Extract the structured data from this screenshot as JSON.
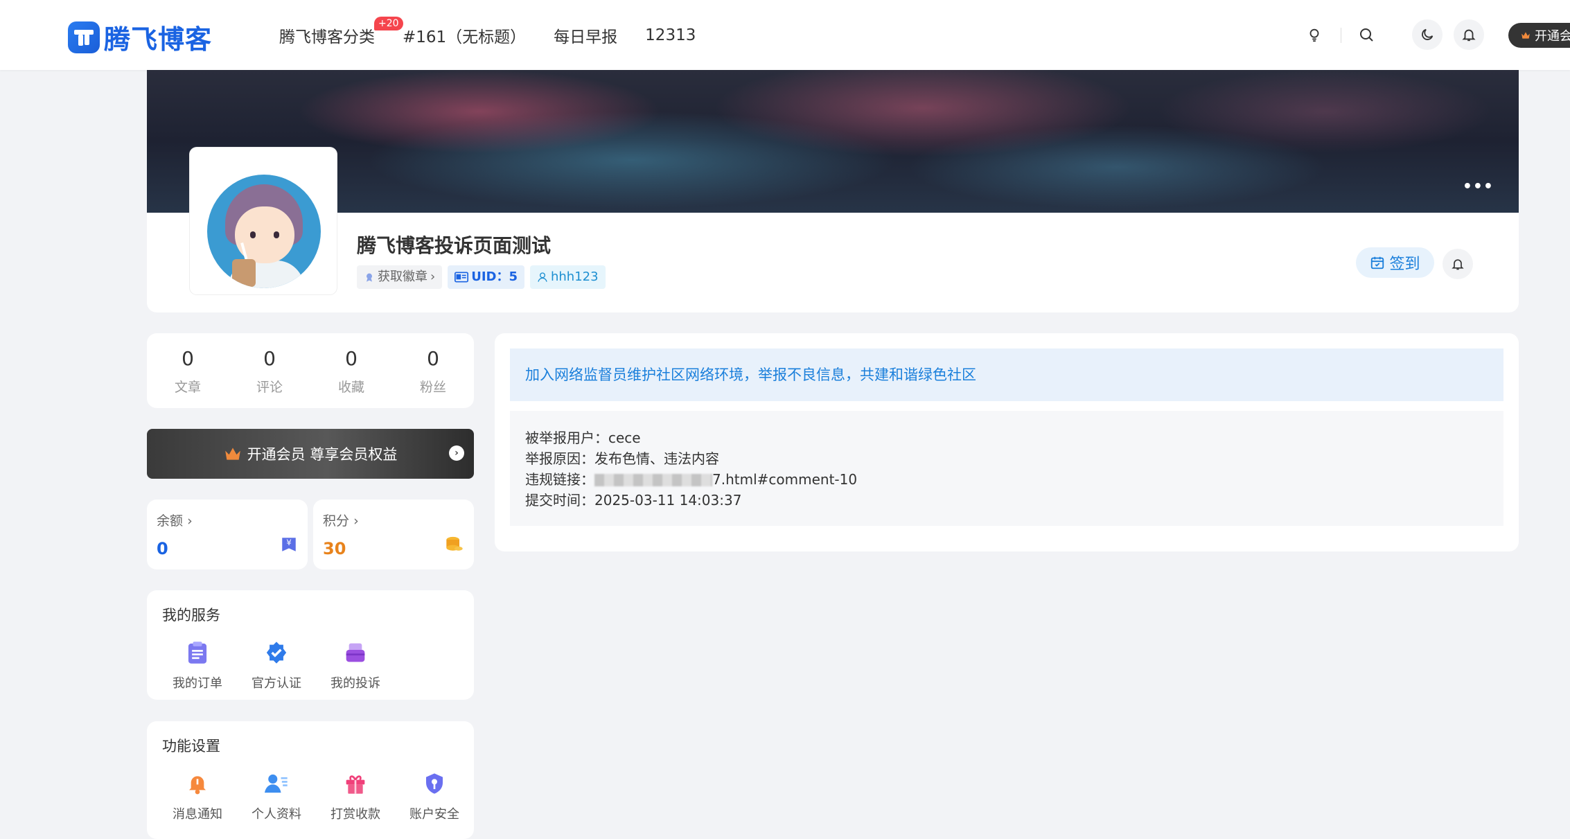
{
  "header": {
    "logo_text": "腾飞博客",
    "nav": [
      {
        "label": "腾飞博客分类",
        "badge": "+20"
      },
      {
        "label": "#161（无标题）"
      },
      {
        "label": "每日早报"
      },
      {
        "label": "12313"
      }
    ],
    "icons": [
      "bulb-icon",
      "search-icon",
      "moon-icon",
      "bell-icon"
    ],
    "vip_label": "开通会员"
  },
  "profile": {
    "name": "腾飞博客投诉页面测试",
    "badge_label": "获取徽章",
    "uid_label": "UID：5",
    "username": "hhh123",
    "signin_label": "签到",
    "more_label": "•••"
  },
  "stats": [
    {
      "value": "0",
      "label": "文章"
    },
    {
      "value": "0",
      "label": "评论"
    },
    {
      "value": "0",
      "label": "收藏"
    },
    {
      "value": "0",
      "label": "粉丝"
    }
  ],
  "vip_banner": {
    "label": "开通会员 尊享会员权益"
  },
  "wallet": {
    "balance": {
      "label": "余额",
      "value": "0",
      "color": "#1a63e2"
    },
    "points": {
      "label": "积分",
      "value": "30",
      "color": "#e8831c"
    }
  },
  "services": {
    "title": "我的服务",
    "items": [
      {
        "label": "我的订单",
        "icon": "clipboard-icon"
      },
      {
        "label": "官方认证",
        "icon": "verified-icon"
      },
      {
        "label": "我的投诉",
        "icon": "complaint-icon"
      }
    ]
  },
  "settings": {
    "title": "功能设置",
    "items": [
      {
        "label": "消息通知",
        "icon": "bell-icon"
      },
      {
        "label": "个人资料",
        "icon": "profile-icon"
      },
      {
        "label": "打赏收款",
        "icon": "gift-icon"
      },
      {
        "label": "账户安全",
        "icon": "shield-icon"
      }
    ]
  },
  "report": {
    "notice": "加入网络监督员维护社区网络环境，举报不良信息，共建和谐绿色社区",
    "rows": {
      "user_label": "被举报用户：",
      "user_value": "cece",
      "reason_label": "举报原因：",
      "reason_value": "发布色情、违法内容",
      "link_label": "违规链接：",
      "link_value": "7.html#comment-10",
      "time_label": "提交时间：",
      "time_value": "2025-03-11 14:03:37"
    }
  }
}
